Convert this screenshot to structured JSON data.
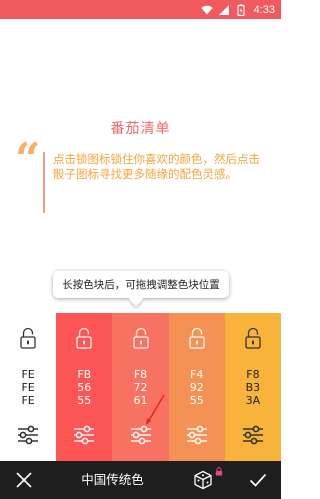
{
  "status_bar": {
    "time": "4:33",
    "color": "#f05a5f",
    "icons": [
      "wifi-icon",
      "signal-icon",
      "battery-icon"
    ]
  },
  "header": {
    "title": "番茄清单",
    "quote": "点击锁图标锁住你喜欢的颜色，然后点击骰子图标寻找更多随缘的配色灵感。"
  },
  "tooltip": {
    "text": "长按色块后，可拖拽调整色块位置"
  },
  "columns": [
    {
      "bg": "#FEFEFE",
      "fg": "#222222",
      "hex": [
        "FE",
        "FE",
        "FE"
      ],
      "locked": false
    },
    {
      "bg": "#FB5655",
      "fg": "#ffffff",
      "hex": [
        "FB",
        "56",
        "55"
      ],
      "locked": false
    },
    {
      "bg": "#F87261",
      "fg": "#ffffff",
      "hex": [
        "F8",
        "72",
        "61"
      ],
      "locked": false
    },
    {
      "bg": "#F49255",
      "fg": "#ffffff",
      "hex": [
        "F4",
        "92",
        "55"
      ],
      "locked": false
    },
    {
      "bg": "#F8B33A",
      "fg": "#222222",
      "hex": [
        "F8",
        "B3",
        "3A"
      ],
      "locked": false
    }
  ],
  "bottom_bar": {
    "label": "中国传统色",
    "bg": "#1e1e1e",
    "lock_accent": "#e0478a"
  },
  "accent": {
    "title_color": "#f06a64",
    "quote_color": "#f5a43c"
  }
}
